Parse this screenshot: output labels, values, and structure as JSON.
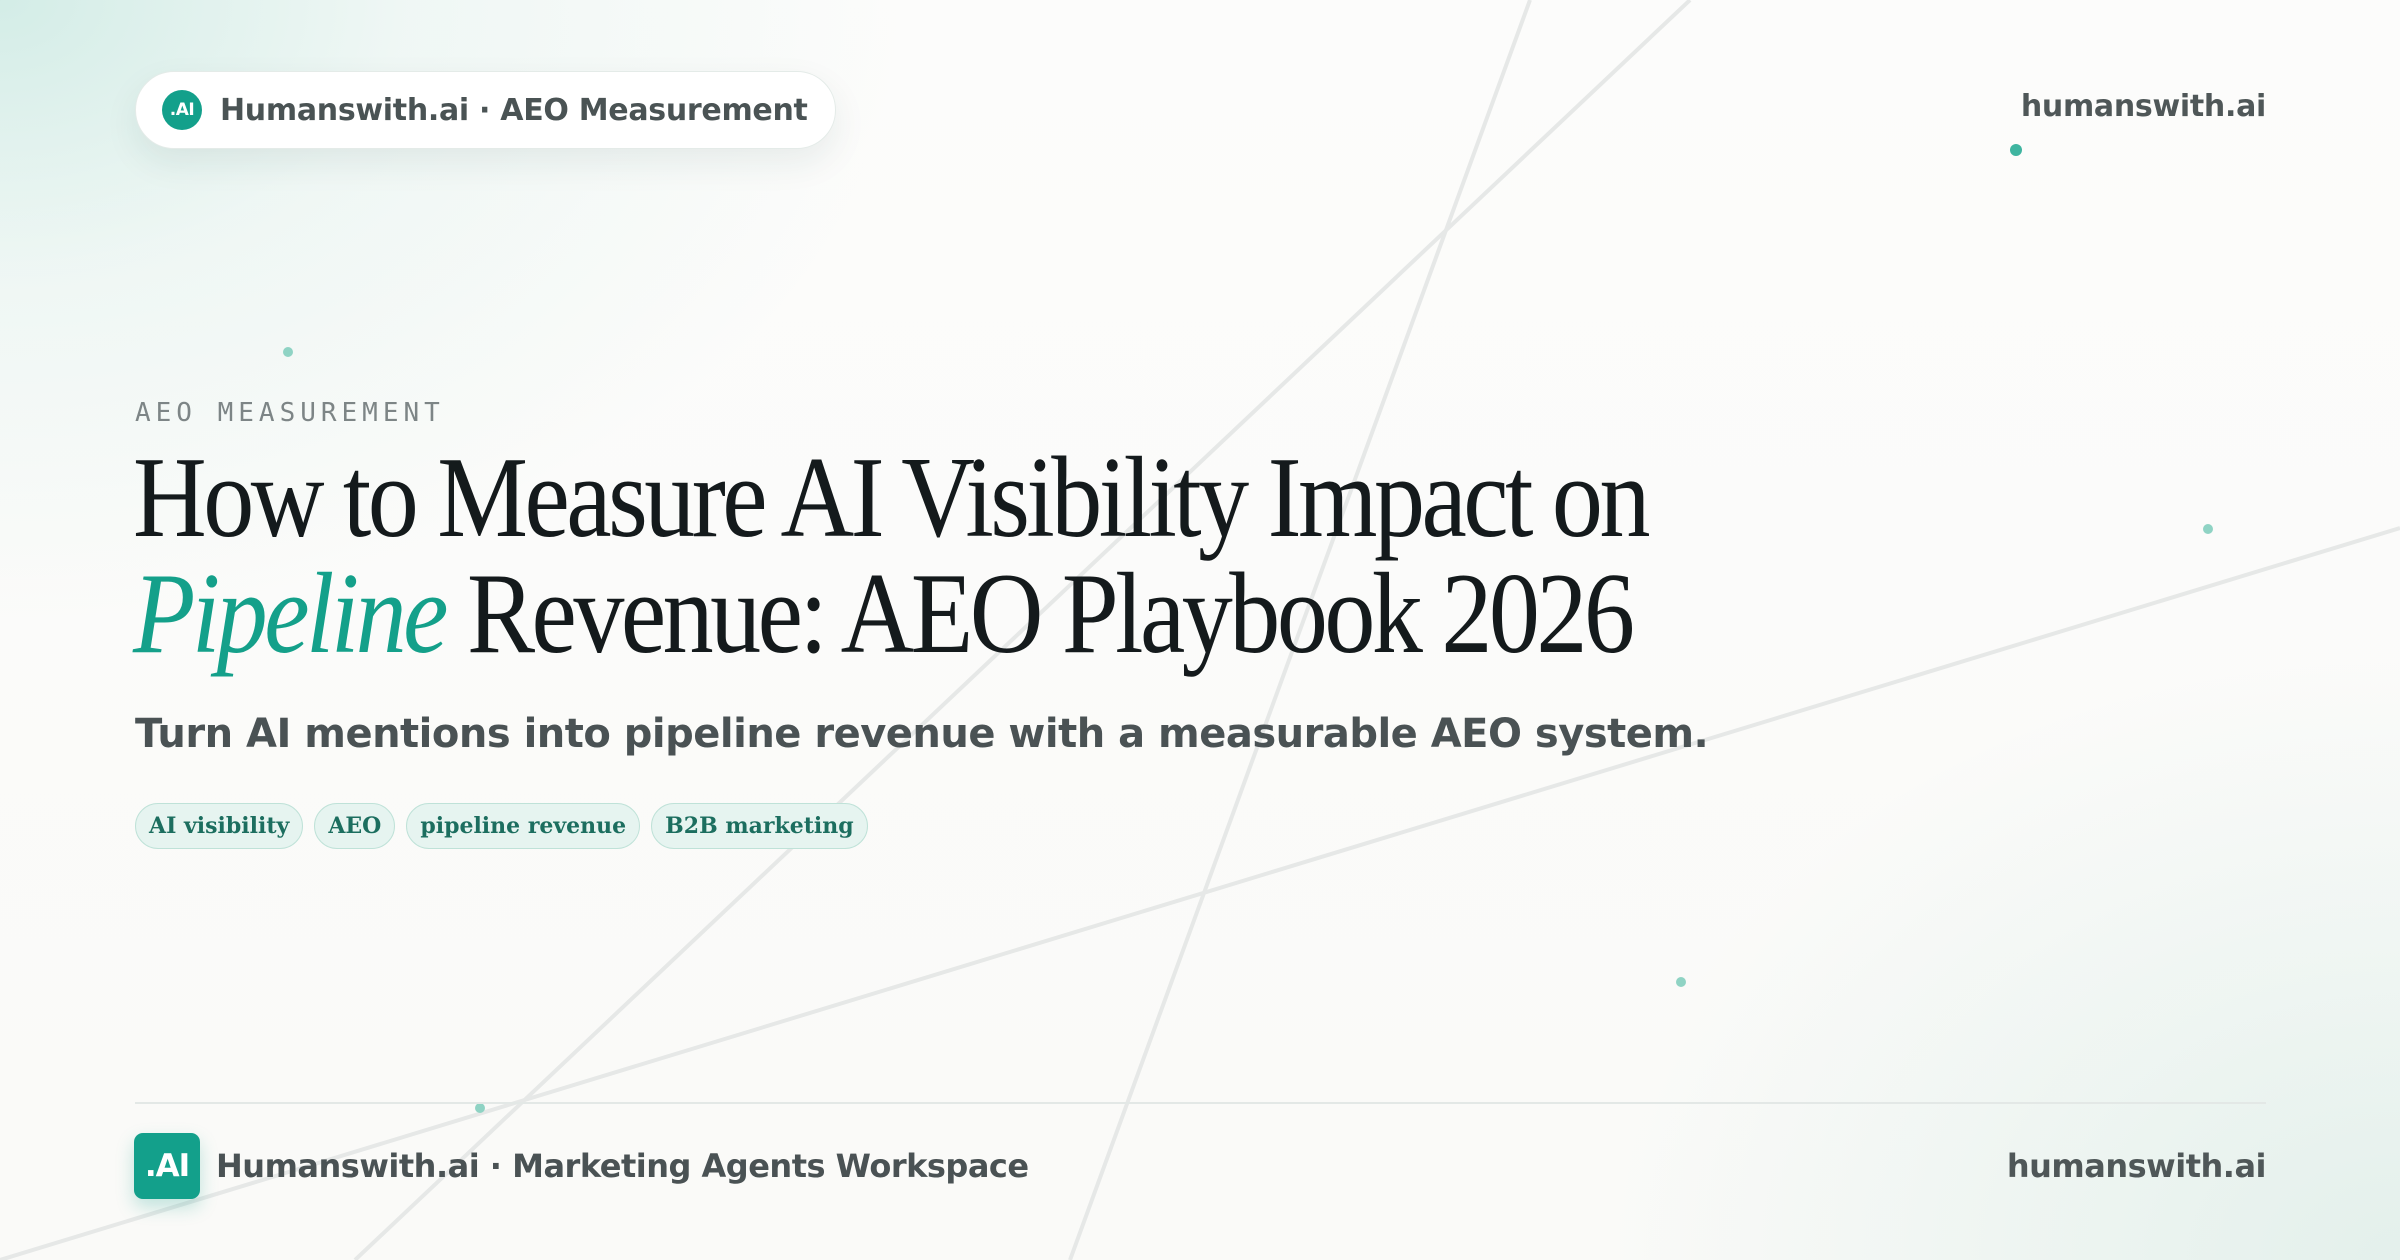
{
  "header": {
    "pill_logo_text": ".AI",
    "pill_label": "Humanswith.ai · AEO Measurement",
    "domain": "humanswith.ai"
  },
  "hero": {
    "eyebrow": "AEO MEASUREMENT",
    "title_line1": "How to Measure AI Visibility Impact on",
    "title_accent": "Pipeline",
    "title_line2_rest": " Revenue: AEO Playbook 2026",
    "subtitle": "Turn AI mentions into pipeline revenue with a measurable AEO system.",
    "tags": [
      "AI visibility",
      "AEO",
      "pipeline revenue",
      "B2B marketing"
    ]
  },
  "footer": {
    "logo_text": ".AI",
    "label": "Humanswith.ai · Marketing Agents Workspace",
    "domain": "humanswith.ai"
  },
  "colors": {
    "accent": "#14a08a",
    "text_dark": "#141a1c",
    "text_muted": "#4a5254"
  }
}
